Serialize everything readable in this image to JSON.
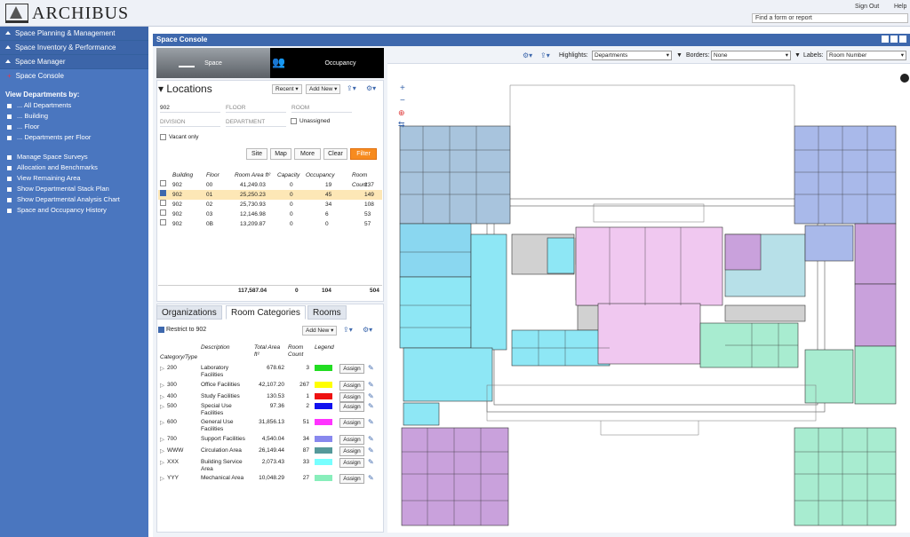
{
  "app": {
    "name": "ARCHIBUS",
    "sign_out": "Sign Out",
    "help": "Help",
    "find_placeholder": "Find a form or report"
  },
  "sidebar": {
    "sections": [
      {
        "label": "Space Planning & Management"
      },
      {
        "label": "Space Inventory & Performance"
      },
      {
        "label": "Space Manager"
      }
    ],
    "current": "Space Console",
    "view_label": "View Departments by:",
    "view_items": [
      "... All Departments",
      "... Building",
      "... Floor",
      "... Departments per Floor"
    ],
    "tasks": [
      "Manage Space Surveys",
      "Allocation and Benchmarks",
      "View Remaining Area",
      "Show Departmental Stack Plan",
      "Show Departmental Analysis Chart",
      "Space and Occupancy History"
    ]
  },
  "console": {
    "title": "Space Console",
    "toggle": {
      "space": "Space",
      "occupancy": "Occupancy"
    }
  },
  "locations": {
    "title": "Locations",
    "recent": "Recent",
    "add_new": "Add New",
    "filters": {
      "building": "902",
      "floor": "FLOOR",
      "room": "ROOM",
      "division": "DIVISION",
      "department": "DEPARTMENT",
      "unassigned": "Unassigned",
      "vacant": "Vacant only"
    },
    "buttons": {
      "site": "Site",
      "map": "Map",
      "more": "More",
      "clear": "Clear",
      "filter": "Filter"
    },
    "columns": {
      "building": "Building",
      "floor": "Floor",
      "area": "Room Area ft²",
      "capacity": "Capacity",
      "occupancy": "Occupancy",
      "count": "Room Count"
    },
    "rows": [
      {
        "building": "902",
        "floor": "00",
        "area": "41,249.03",
        "capacity": "0",
        "occupancy": "19",
        "count": "137",
        "checked": false
      },
      {
        "building": "902",
        "floor": "01",
        "area": "25,250.23",
        "capacity": "0",
        "occupancy": "45",
        "count": "149",
        "checked": true
      },
      {
        "building": "902",
        "floor": "02",
        "area": "25,730.93",
        "capacity": "0",
        "occupancy": "34",
        "count": "108",
        "checked": false
      },
      {
        "building": "902",
        "floor": "03",
        "area": "12,146.98",
        "capacity": "0",
        "occupancy": "6",
        "count": "53",
        "checked": false
      },
      {
        "building": "902",
        "floor": "0B",
        "area": "13,209.87",
        "capacity": "0",
        "occupancy": "0",
        "count": "57",
        "checked": false
      }
    ],
    "totals": {
      "area": "117,587.04",
      "capacity": "0",
      "occupancy": "104",
      "count": "504"
    }
  },
  "categories": {
    "tabs": [
      "Organizations",
      "Room Categories",
      "Rooms"
    ],
    "restrict": "Restrict to 902",
    "add_new": "Add New",
    "columns": {
      "cat": "Category/Type",
      "desc": "Description",
      "area": "Total Area ft²",
      "count": "Room Count",
      "legend": "Legend"
    },
    "assign_label": "Assign",
    "rows": [
      {
        "code": "200",
        "desc": "Laboratory Facilities",
        "area": "678.62",
        "count": "3",
        "color": "#22dd22"
      },
      {
        "code": "300",
        "desc": "Office Facilities",
        "area": "42,107.20",
        "count": "267",
        "color": "#ffff00"
      },
      {
        "code": "400",
        "desc": "Study Facilities",
        "area": "130.53",
        "count": "1",
        "color": "#ee1111"
      },
      {
        "code": "500",
        "desc": "Special Use Facilities",
        "area": "97.36",
        "count": "2",
        "color": "#1111ee"
      },
      {
        "code": "600",
        "desc": "General Use Facilities",
        "area": "31,856.13",
        "count": "51",
        "color": "#ff33ff"
      },
      {
        "code": "700",
        "desc": "Support Facilities",
        "area": "4,540.04",
        "count": "34",
        "color": "#8888ee"
      },
      {
        "code": "WWW",
        "desc": "Circulation Area",
        "area": "26,149.44",
        "count": "87",
        "color": "#55999a"
      },
      {
        "code": "XXX",
        "desc": "Building Service Area",
        "area": "2,073.43",
        "count": "33",
        "color": "#77ffff"
      },
      {
        "code": "YYY",
        "desc": "Mechanical Area",
        "area": "10,048.29",
        "count": "27",
        "color": "#88eebb"
      }
    ]
  },
  "plan": {
    "highlights_label": "Highlights:",
    "highlights_value": "Departments",
    "borders_label": "Borders:",
    "borders_value": "None",
    "labels_label": "Labels:",
    "labels_value": "Room Number"
  }
}
